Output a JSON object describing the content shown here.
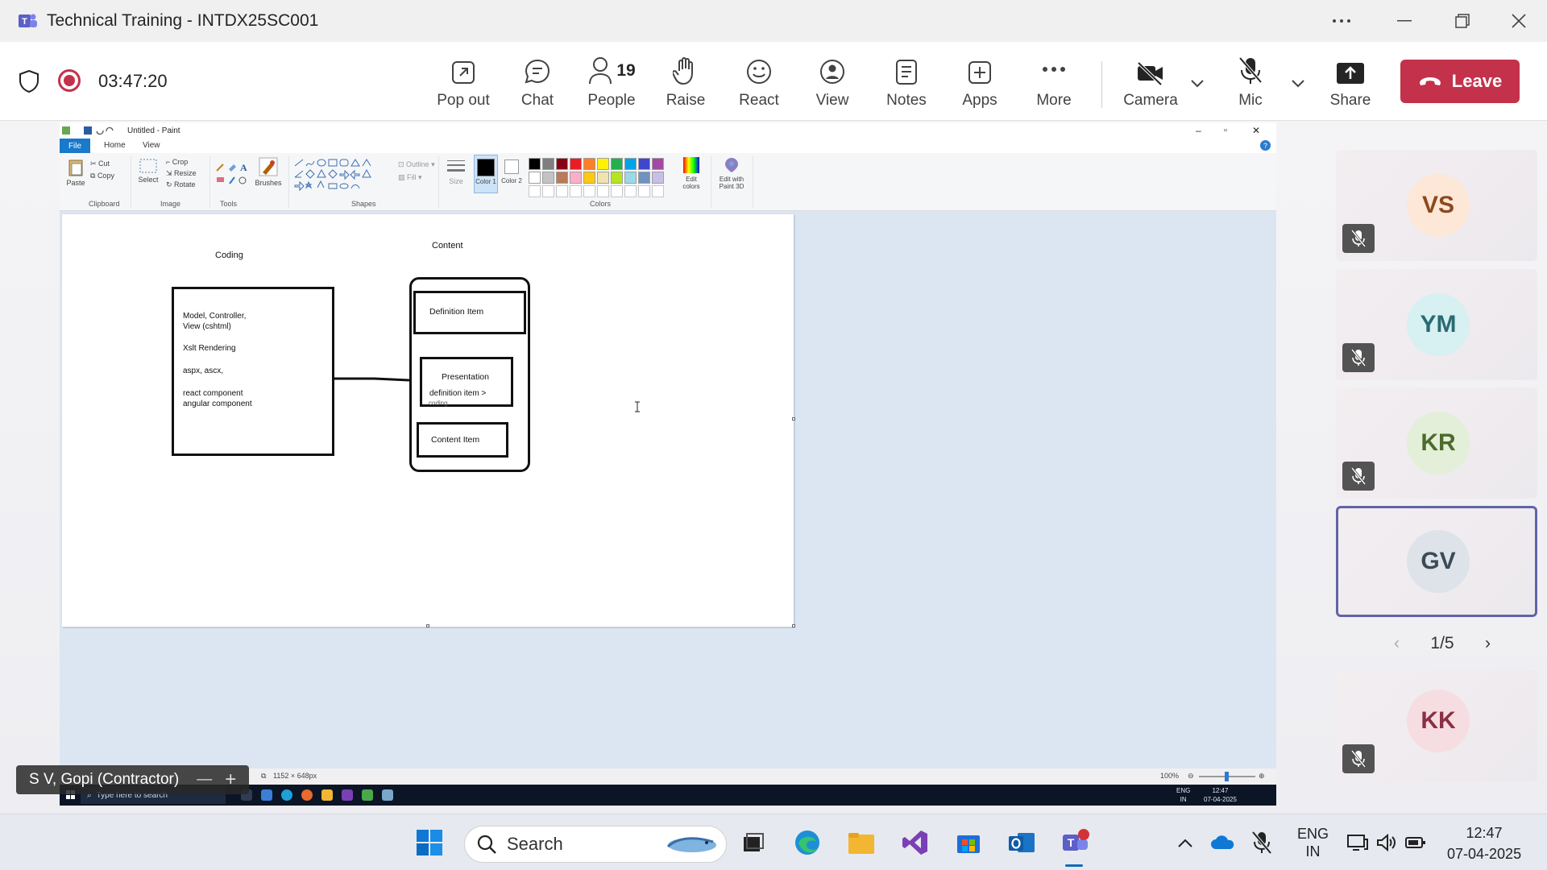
{
  "window": {
    "title": "Technical Training - INTDX25SC001"
  },
  "meeting": {
    "timer": "03:47:20",
    "toolbar": {
      "pop_out": "Pop out",
      "chat": "Chat",
      "people": "People",
      "people_count": "19",
      "raise": "Raise",
      "react": "React",
      "view": "View",
      "notes": "Notes",
      "apps": "Apps",
      "more": "More",
      "camera": "Camera",
      "mic": "Mic",
      "share": "Share",
      "leave": "Leave"
    }
  },
  "shared_screen": {
    "paint_title": "Untitled - Paint",
    "tabs": [
      "File",
      "Home",
      "View"
    ],
    "ribbon": {
      "paste": "Paste",
      "cut": "Cut",
      "copy": "Copy",
      "select": "Select",
      "crop": "Crop",
      "resize": "Resize",
      "rotate": "Rotate",
      "brushes": "Brushes",
      "outline": "Outline",
      "fill": "Fill",
      "size": "Size",
      "color1": "Color 1",
      "color2": "Color 2",
      "edit_colors": "Edit colors",
      "edit_paint3d": "Edit with Paint 3D",
      "groups": [
        "Clipboard",
        "Image",
        "Tools",
        "Shapes",
        "Colors"
      ],
      "palette": [
        "#000000",
        "#7f7f7f",
        "#880015",
        "#ed1c24",
        "#ff7f27",
        "#fff200",
        "#22b14c",
        "#00a2e8",
        "#3f48cc",
        "#a349a4",
        "#ffffff",
        "#c3c3c3",
        "#b97a57",
        "#ffaec9",
        "#ffc90e",
        "#efe4b0",
        "#b5e61d",
        "#99d9ea",
        "#7092be",
        "#c8bfe7"
      ]
    },
    "canvas": {
      "label_coding": "Coding",
      "label_content": "Content",
      "coding_lines": [
        "Model, Controller,",
        "View (cshtml)",
        "Xslt Rendering",
        "aspx, ascx,",
        "react component",
        "angular component"
      ],
      "definition_item": "Definition Item",
      "presentation": "Presentation",
      "presentation_sub": "definition item >",
      "presentation_overlap": "coding",
      "content_item": "Content Item"
    },
    "status": {
      "size": "1152 × 648px",
      "zoom": "100%"
    },
    "inner_taskbar": {
      "search_placeholder": "Type here to search",
      "lang": "ENG",
      "region": "IN",
      "time": "12:47",
      "date": "07-04-2025"
    },
    "presenter": "S V, Gopi (Contractor)"
  },
  "participants": {
    "tiles": [
      {
        "initials": "VS",
        "color": "#fde7d6",
        "text_color": "#8a4a1e"
      },
      {
        "initials": "YM",
        "color": "#d7f0f2",
        "text_color": "#2a6b72"
      },
      {
        "initials": "KR",
        "color": "#e3efd8",
        "text_color": "#4c6b2c"
      },
      {
        "initials": "GV",
        "color": "#dde3e8",
        "text_color": "#3c4a56"
      },
      {
        "initials": "KK",
        "color": "#f6dde2",
        "text_color": "#8a2f44"
      }
    ],
    "page": "1/5"
  },
  "taskbar": {
    "search": "Search",
    "lang": "ENG",
    "region": "IN",
    "time": "12:47",
    "date": "07-04-2025"
  }
}
